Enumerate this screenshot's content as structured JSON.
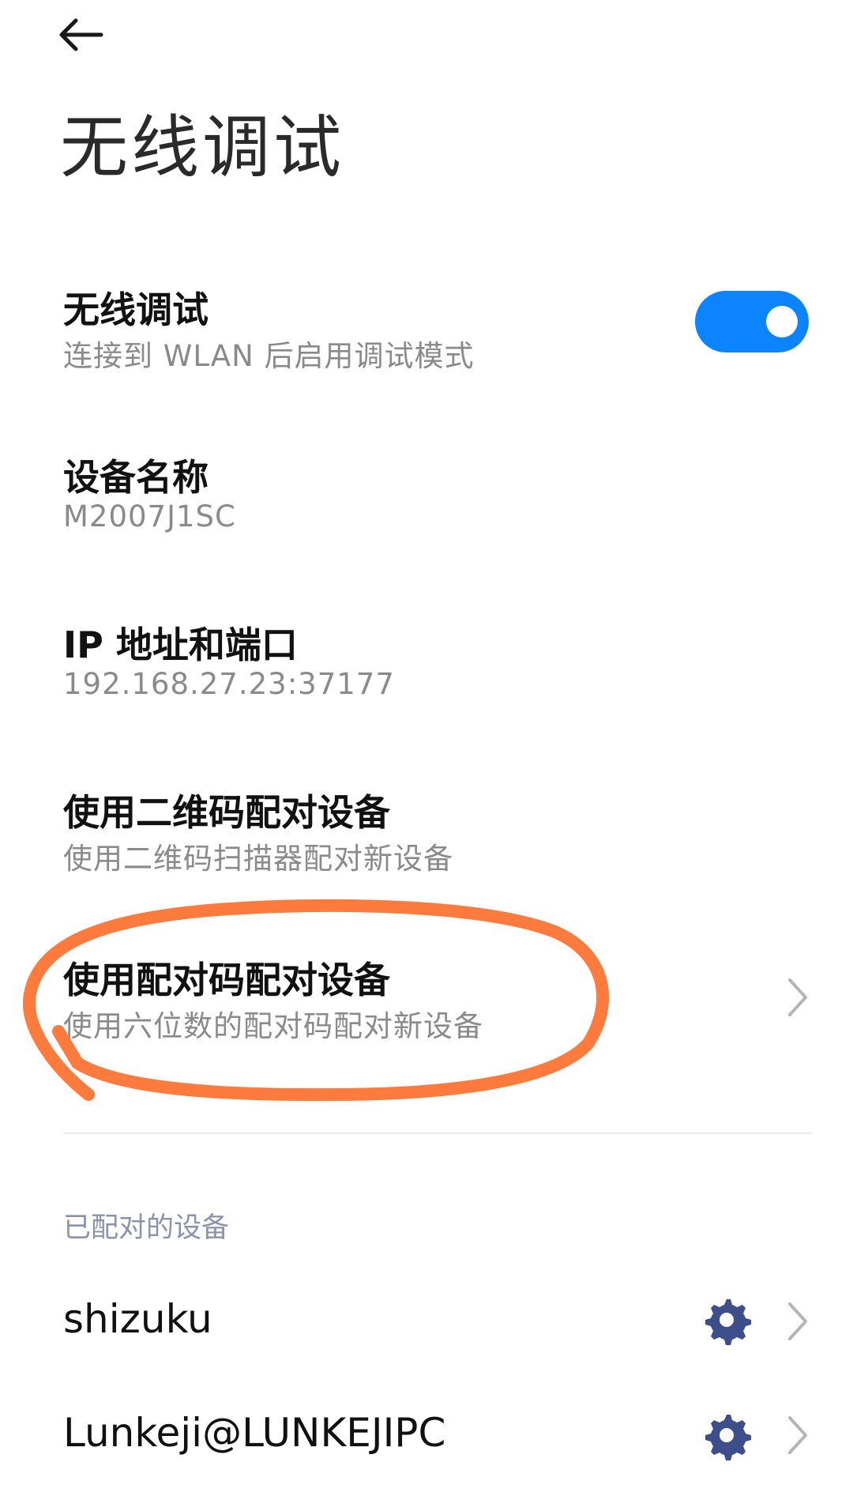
{
  "header": {
    "back_icon": "arrow-left-icon",
    "title": "无线调试"
  },
  "wireless_debugging": {
    "title": "无线调试",
    "subtitle": "连接到 WLAN 后启用调试模式",
    "enabled": true,
    "toggle_color": "#0d84ff"
  },
  "device_name": {
    "title": "设备名称",
    "value": "M2007J1SC"
  },
  "ip_port": {
    "title": "IP 地址和端口",
    "value": "192.168.27.23:37177"
  },
  "pair_qr": {
    "title": "使用二维码配对设备",
    "subtitle": "使用二维码扫描器配对新设备"
  },
  "pair_code": {
    "title": "使用配对码配对设备",
    "subtitle": "使用六位数的配对码配对新设备",
    "chevron_icon": "chevron-right-icon",
    "annotation_color": "#ff7a3d"
  },
  "paired_devices": {
    "header": "已配对的设备",
    "items": [
      {
        "name": "shizuku",
        "gear_icon": "gear-icon",
        "chevron_icon": "chevron-right-icon"
      },
      {
        "name": "Lunkeji@LUNKEJIPC",
        "gear_icon": "gear-icon",
        "chevron_icon": "chevron-right-icon"
      }
    ],
    "gear_color": "#3c4f8a"
  }
}
